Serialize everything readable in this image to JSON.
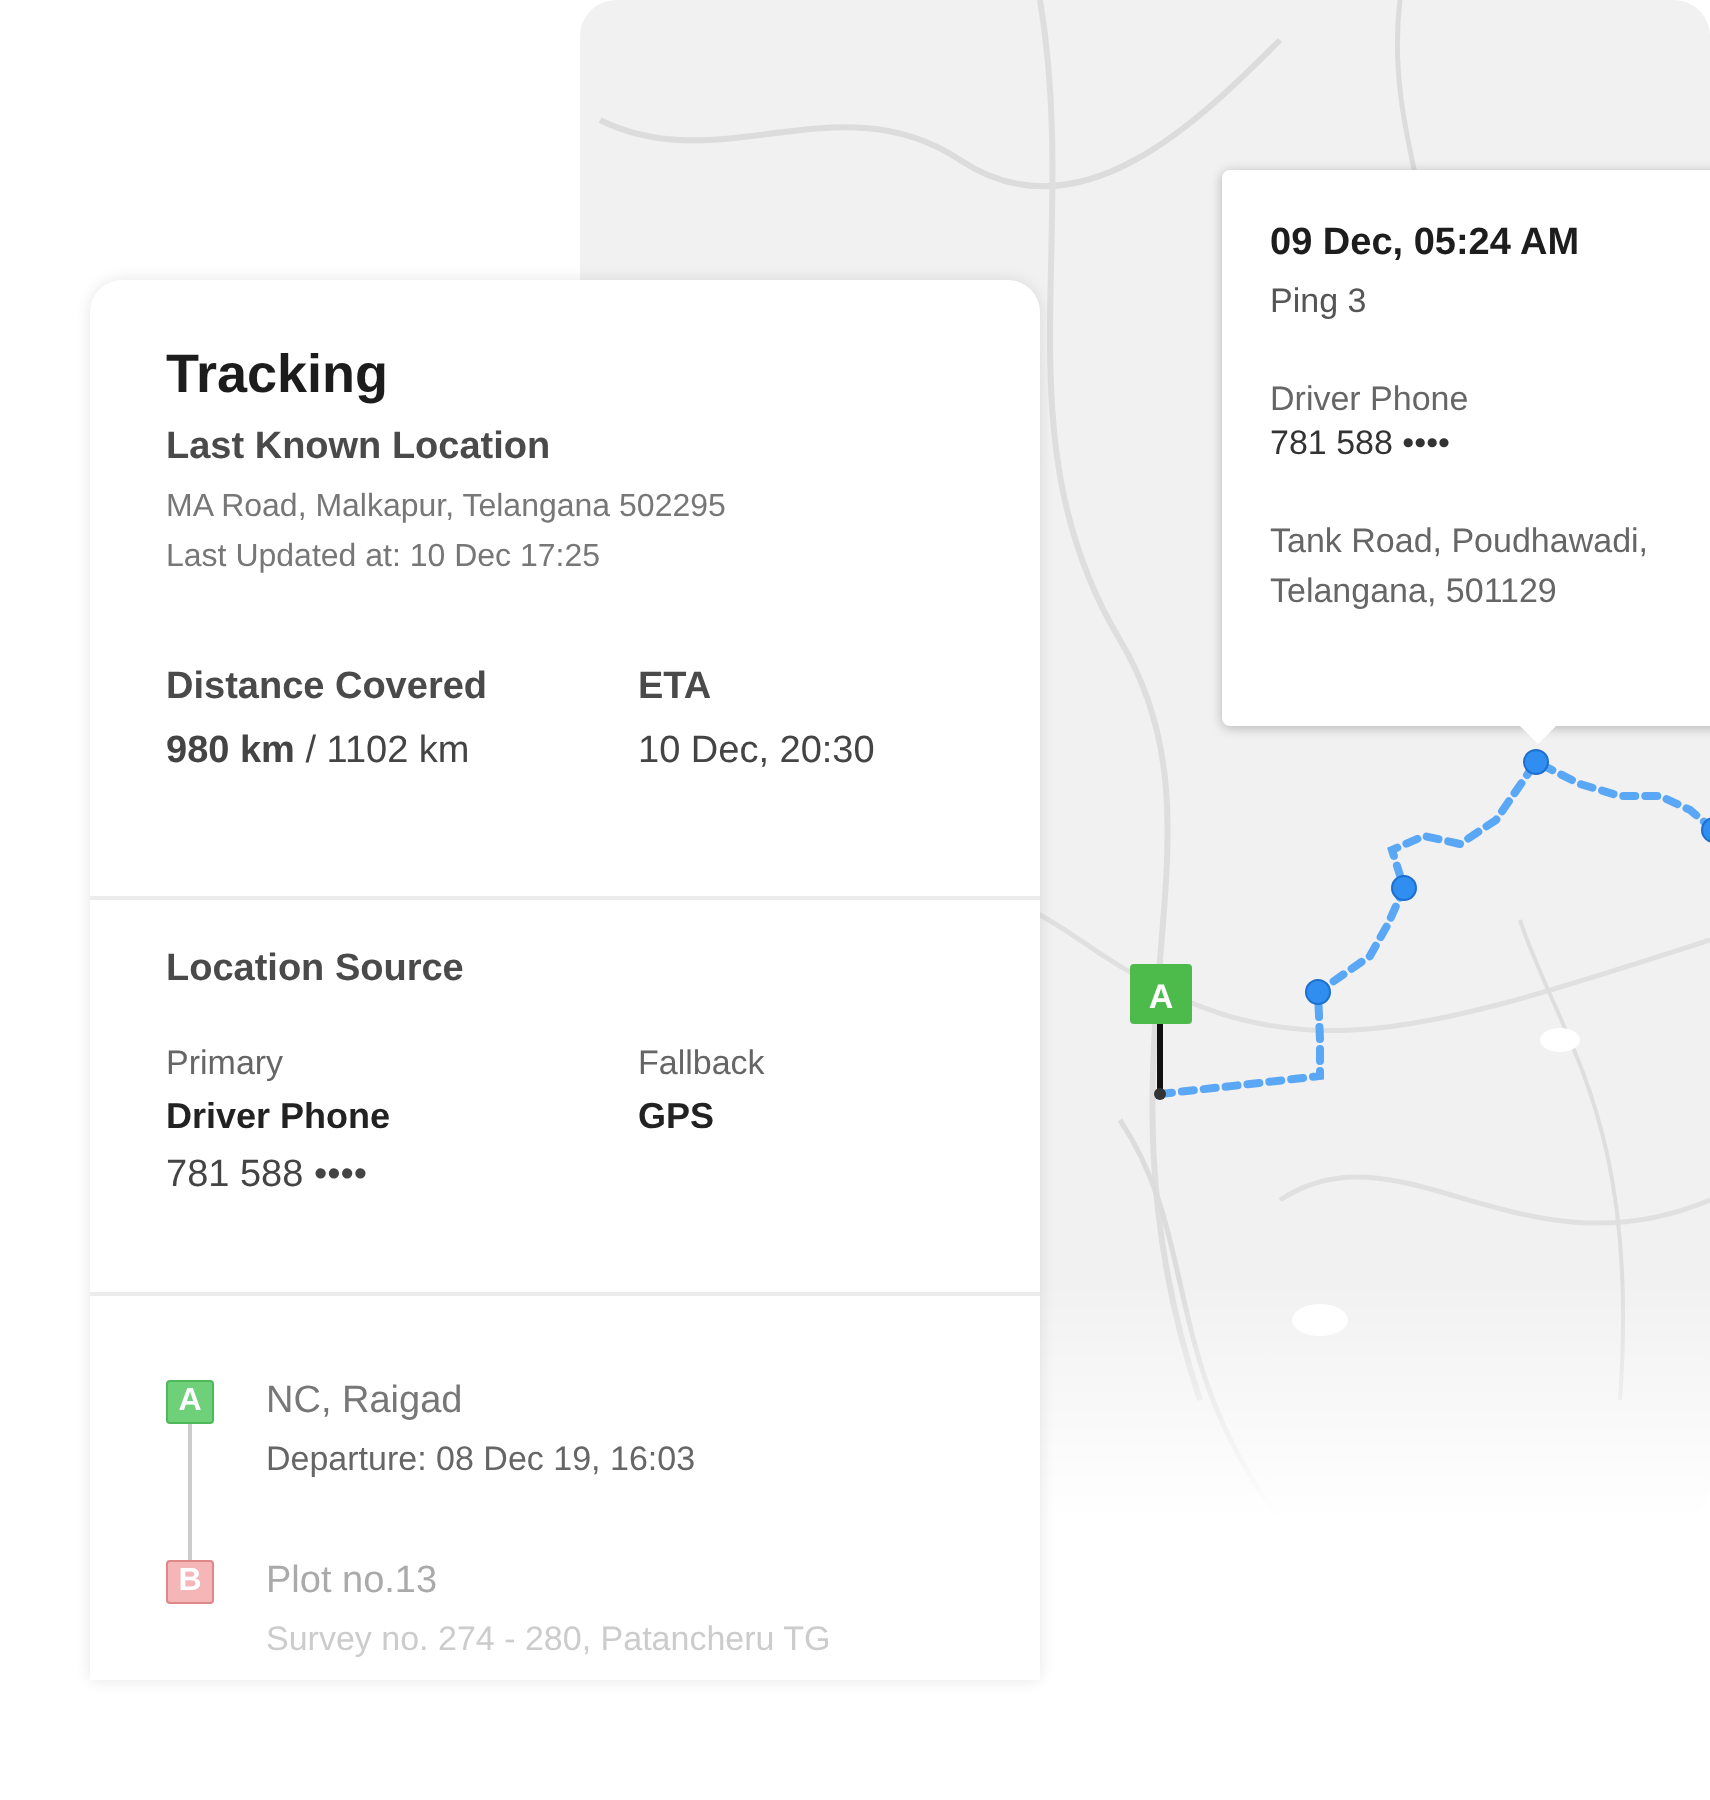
{
  "map": {
    "start_marker": {
      "label": "A"
    },
    "popup": {
      "time": "09 Dec, 05:24 AM",
      "ping": "Ping 3",
      "source": "Driver Phone",
      "phone": "781 588 ••••",
      "address_lines": [
        "Tank Road, Poudhawadi,",
        "Telangana, 501129"
      ]
    }
  },
  "tracking": {
    "title": "Tracking",
    "last_known": {
      "heading": "Last Known Location",
      "address": "MA Road, Malkapur, Telangana 502295",
      "updated": "Last Updated at: 10 Dec 17:25"
    },
    "distance": {
      "label": "Distance Covered",
      "value": "**980 km** / 1102 km"
    },
    "eta": {
      "label": "ETA",
      "value": "10 Dec, 20:30"
    },
    "location_source": {
      "heading": "Location Source",
      "primary": {
        "label": "Primary",
        "name": "Driver Phone",
        "phone": "781 588 ••••"
      },
      "fallback": {
        "label": "Fallback",
        "name": "GPS"
      }
    },
    "stops": [
      {
        "kind": "origin",
        "badge": "A",
        "color": "#6fd07a",
        "name": "NC, Raigad",
        "detail": "Departure: 08 Dec 19, 16:03"
      },
      {
        "kind": "destination",
        "badge": "B",
        "color": "#f4b6b6",
        "name": "Plot no.13",
        "detail": "Survey no. 274 - 280, Patancheru TG"
      }
    ]
  }
}
